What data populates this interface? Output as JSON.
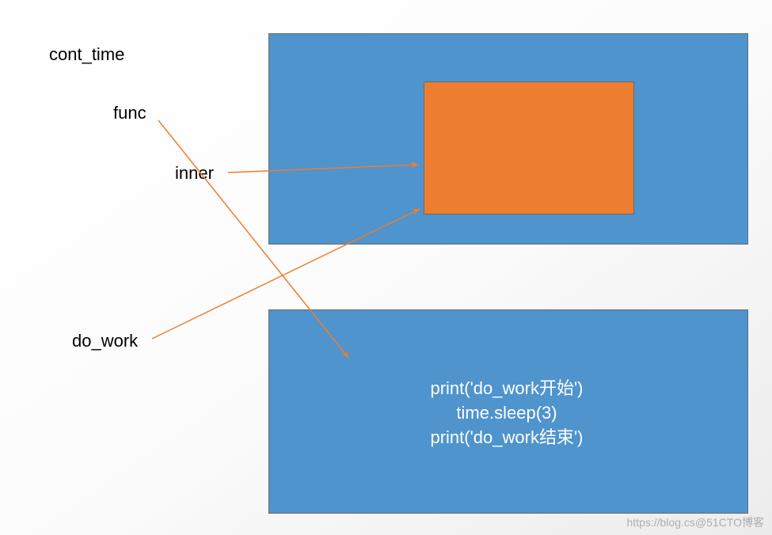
{
  "labels": {
    "cont_time": "cont_time",
    "func": "func",
    "inner": "inner",
    "do_work": "do_work"
  },
  "code": {
    "line1": "print('do_work开始')",
    "line2": "time.sleep(3)",
    "line3": "print('do_work结束')"
  },
  "colors": {
    "blue": "#4f94cd",
    "orange": "#ed7d31",
    "arrow": "#ed7d31"
  },
  "watermark": "https://blog.cs@51CTO博客"
}
